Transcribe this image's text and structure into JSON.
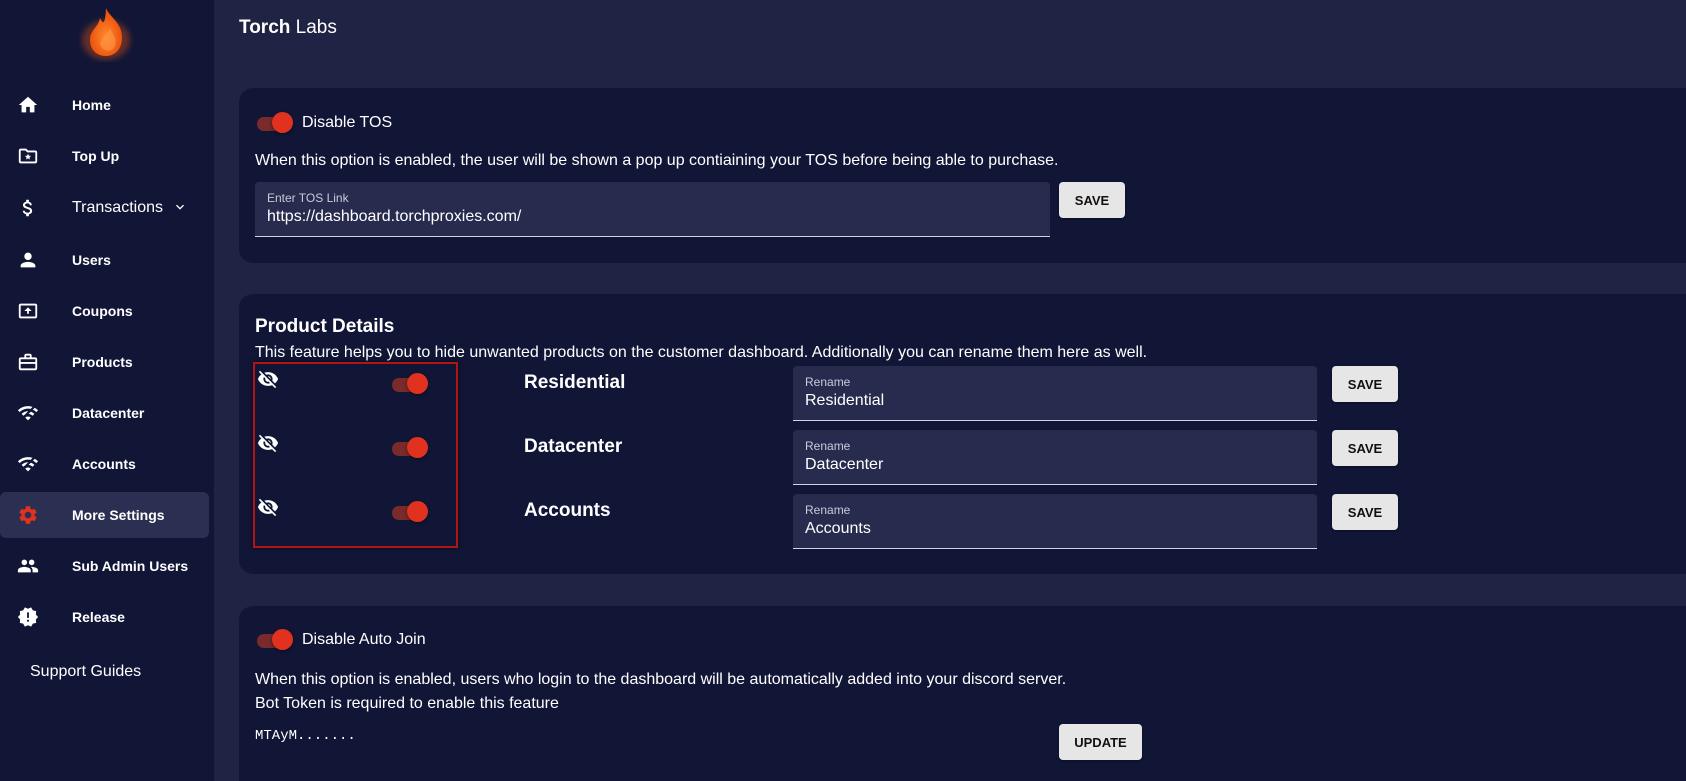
{
  "brand": {
    "bold": "Torch",
    "rest": "Labs"
  },
  "sidebar": {
    "items": [
      {
        "label": "Home",
        "icon": "home-icon"
      },
      {
        "label": "Top Up",
        "icon": "folder-star-icon"
      },
      {
        "label": "Transactions",
        "icon": "dollar-icon"
      },
      {
        "label": "Users",
        "icon": "user-icon"
      },
      {
        "label": "Coupons",
        "icon": "coupon-icon"
      },
      {
        "label": "Products",
        "icon": "briefcase-icon"
      },
      {
        "label": "Datacenter",
        "icon": "wifi-icon"
      },
      {
        "label": "Accounts",
        "icon": "wifi-icon"
      },
      {
        "label": "More Settings",
        "icon": "gear-icon"
      },
      {
        "label": "Sub Admin Users",
        "icon": "people-icon"
      },
      {
        "label": "Release",
        "icon": "alert-badge-icon"
      }
    ],
    "support": "Support Guides",
    "active": "More Settings"
  },
  "tos": {
    "title": "Disable TOS",
    "description": "When this option is enabled, the user will be shown a pop up contiaining your TOS before being able to purchase.",
    "field_label": "Enter TOS Link",
    "field_value": "https://dashboard.torchproxies.com/",
    "save_label": "SAVE",
    "enabled": true
  },
  "products": {
    "title": "Product Details",
    "description": "This feature helps you to hide unwanted products on the customer dashboard. Additionally you can rename them here as well.",
    "rows": [
      {
        "name": "Residential",
        "field_label": "Rename",
        "field_value": "Residential",
        "save_label": "SAVE",
        "enabled": true
      },
      {
        "name": "Datacenter",
        "field_label": "Rename",
        "field_value": "Datacenter",
        "save_label": "SAVE",
        "enabled": true
      },
      {
        "name": "Accounts",
        "field_label": "Rename",
        "field_value": "Accounts",
        "save_label": "SAVE",
        "enabled": true
      }
    ]
  },
  "autojoin": {
    "title": "Disable Auto Join",
    "description": "When this option is enabled, users who login to the dashboard will be automatically added into your discord server.",
    "note": "Bot Token is required to enable this feature",
    "token": "MTAyM.......",
    "update_label": "UPDATE",
    "enabled": true
  },
  "colors": {
    "accent": "#e0321f",
    "background": "#1f2444",
    "card": "#111637",
    "sidebar": "#111637"
  }
}
